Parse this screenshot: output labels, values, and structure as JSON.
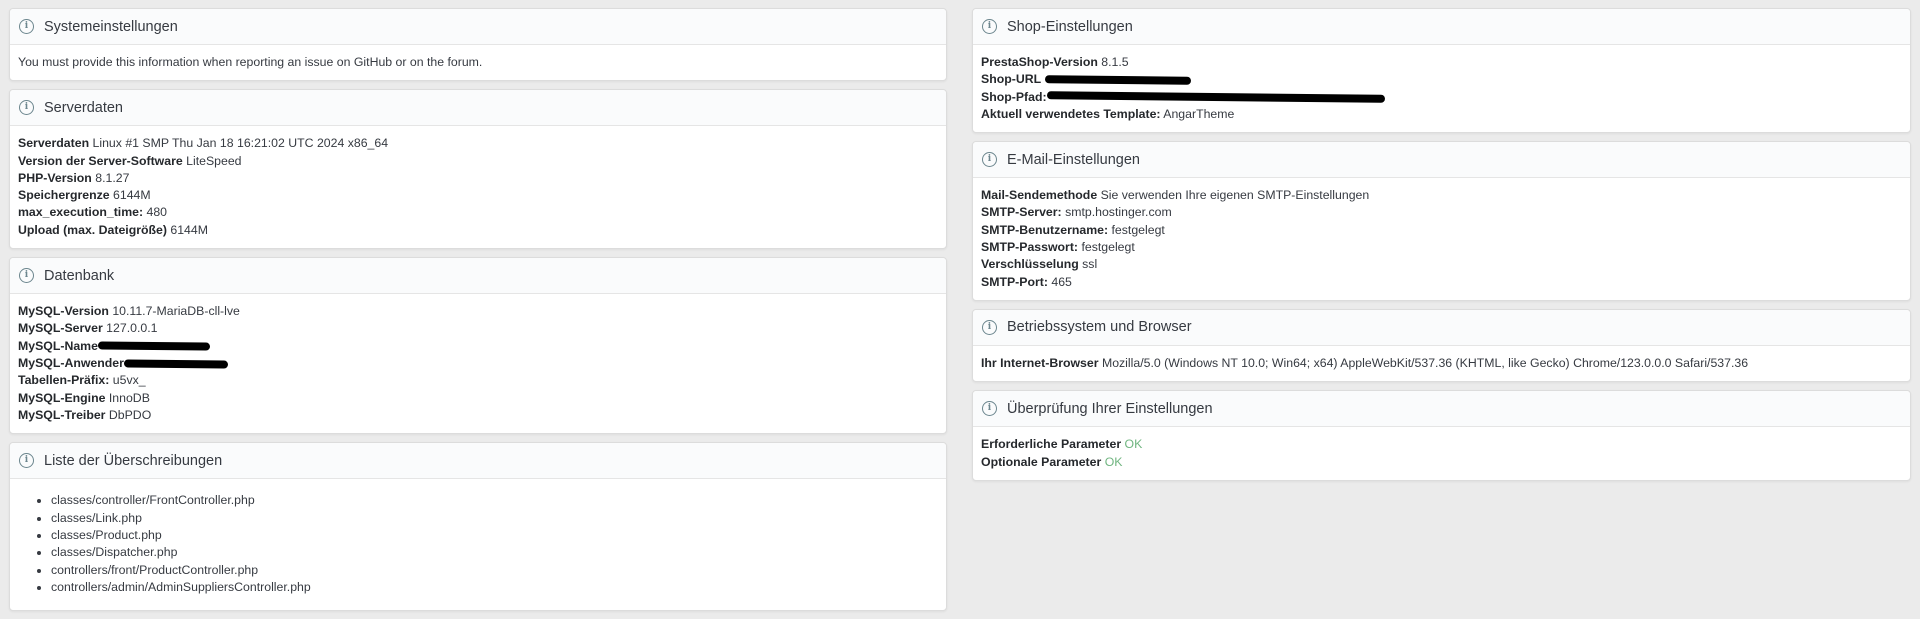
{
  "left": {
    "system": {
      "title": "Systemeinstellungen",
      "note": "You must provide this information when reporting an issue on GitHub or on the forum."
    },
    "server": {
      "title": "Serverdaten",
      "rows": [
        {
          "label": "Serverdaten",
          "value": "Linux #1 SMP Thu Jan 18 16:21:02 UTC 2024 x86_64"
        },
        {
          "label": "Version der Server-Software",
          "value": "LiteSpeed"
        },
        {
          "label": "PHP-Version",
          "value": "8.1.27"
        },
        {
          "label": "Speichergrenze",
          "value": "6144M"
        },
        {
          "label": "max_execution_time:",
          "value": "480"
        },
        {
          "label": "Upload (max. Dateigröße)",
          "value": "6144M"
        }
      ]
    },
    "database": {
      "title": "Datenbank",
      "rows": [
        {
          "label": "MySQL-Version",
          "value": "10.11.7-MariaDB-cll-lve"
        },
        {
          "label": "MySQL-Server",
          "value": "127.0.0.1"
        },
        {
          "label": "MySQL-Name",
          "value": ""
        },
        {
          "label": "MySQL-Anwender",
          "value": ""
        },
        {
          "label": "Tabellen-Präfix:",
          "value": "u5vx_"
        },
        {
          "label": "MySQL-Engine",
          "value": "InnoDB"
        },
        {
          "label": "MySQL-Treiber",
          "value": "DbPDO"
        }
      ]
    },
    "overrides": {
      "title": "Liste der Überschreibungen",
      "items": [
        "classes/controller/FrontController.php",
        "classes/Link.php",
        "classes/Product.php",
        "classes/Dispatcher.php",
        "controllers/front/ProductController.php",
        "controllers/admin/AdminSuppliersController.php"
      ]
    }
  },
  "right": {
    "shop": {
      "title": "Shop-Einstellungen",
      "rows": [
        {
          "label": "PrestaShop-Version",
          "value": "8.1.5"
        },
        {
          "label": "Shop-URL",
          "value": ""
        },
        {
          "label": "Shop-Pfad:",
          "value": ""
        },
        {
          "label": "Aktuell verwendetes Template:",
          "value": "AngarTheme"
        }
      ]
    },
    "mail": {
      "title": "E-Mail-Einstellungen",
      "rows": [
        {
          "label": "Mail-Sendemethode",
          "value": "Sie verwenden Ihre eigenen SMTP-Einstellungen"
        },
        {
          "label": "SMTP-Server:",
          "value": "smtp.hostinger.com"
        },
        {
          "label": "SMTP-Benutzername:",
          "value": "festgelegt"
        },
        {
          "label": "SMTP-Passwort:",
          "value": "festgelegt"
        },
        {
          "label": "Verschlüsselung",
          "value": "ssl"
        },
        {
          "label": "SMTP-Port:",
          "value": "465"
        }
      ]
    },
    "os": {
      "title": "Betriebssystem und Browser",
      "rows": [
        {
          "label": "Ihr Internet-Browser",
          "value": "Mozilla/5.0 (Windows NT 10.0; Win64; x64) AppleWebKit/537.36 (KHTML, like Gecko) Chrome/123.0.0.0 Safari/537.36"
        }
      ]
    },
    "check": {
      "title": "Überprüfung Ihrer Einstellungen",
      "rows": [
        {
          "label": "Erforderliche Parameter",
          "value": "OK"
        },
        {
          "label": "Optionale Parameter",
          "value": "OK"
        }
      ]
    }
  },
  "colors": {
    "ok": "#70b580",
    "background": "#ebebeb",
    "redaction": "#000000"
  },
  "icons": {
    "panel_header": "info-circle-icon"
  }
}
